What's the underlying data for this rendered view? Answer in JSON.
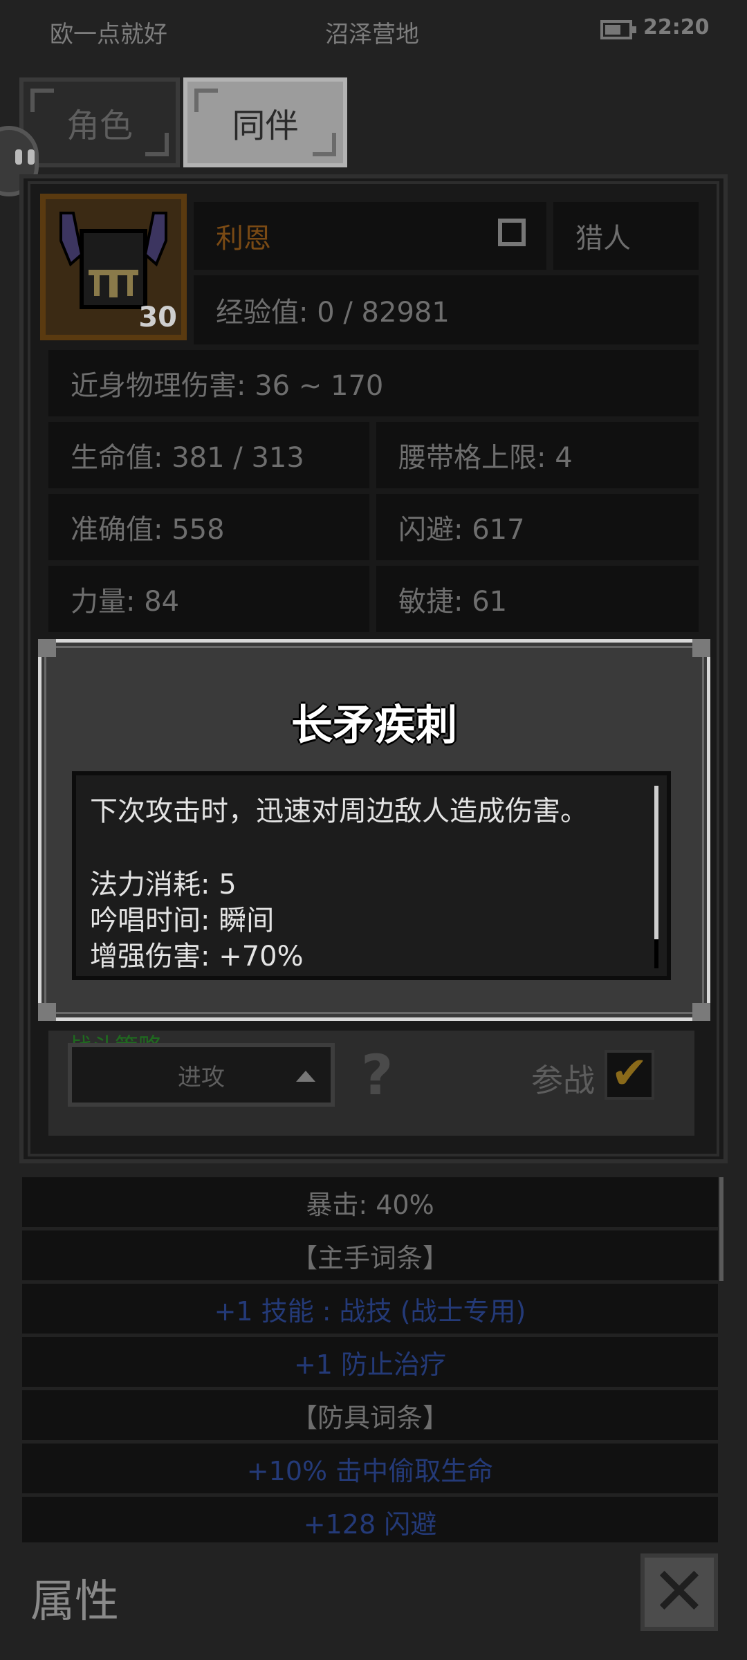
{
  "status_bar": {
    "left_text": "欧一点就好",
    "center_text": "沼泽营地",
    "time": "22:20"
  },
  "tabs": [
    {
      "label": "角色",
      "active": false
    },
    {
      "label": "同伴",
      "active": true
    }
  ],
  "companion": {
    "level": "30",
    "name": "利恩",
    "class": "猎人",
    "experience": "经验值: 0 / 82981",
    "melee_damage": "近身物理伤害: 36 ~ 170",
    "hp": "生命值: 381 / 313",
    "belt_limit": "腰带格上限: 4",
    "accuracy": "准确值: 558",
    "dodge": "闪避: 617",
    "strength": "力量: 84",
    "agility": "敏捷: 61"
  },
  "skill_popup": {
    "title": "长矛疾刺",
    "description": "下次攻击时，迅速对周边敌人造成伤害。",
    "mana_cost": "法力消耗: 5",
    "cast_time": "吟唱时间: 瞬间",
    "damage_boost": "增强伤害: +70%"
  },
  "strategy": {
    "label": "战斗策略",
    "selected": "进攻",
    "help": "?",
    "join_label": "参战",
    "join_checked": true
  },
  "attribute_list": [
    {
      "text": "暴击: 40%",
      "style": "plain"
    },
    {
      "text": "【主手词条】",
      "style": "plain"
    },
    {
      "text": "+1 技能 : 战技 (战士专用)",
      "style": "blue"
    },
    {
      "text": "+1 防止治疗",
      "style": "blue"
    },
    {
      "text": "【防具词条】",
      "style": "plain"
    },
    {
      "text": "+10% 击中偷取生命",
      "style": "blue"
    },
    {
      "text": "+128 闪避",
      "style": "blue"
    }
  ],
  "footer": {
    "title": "属性"
  },
  "colors": {
    "background": "#222222",
    "name_orange": "#7a4a14",
    "blue_affix": "#243a78",
    "strategy_green": "#1f6a1f"
  }
}
